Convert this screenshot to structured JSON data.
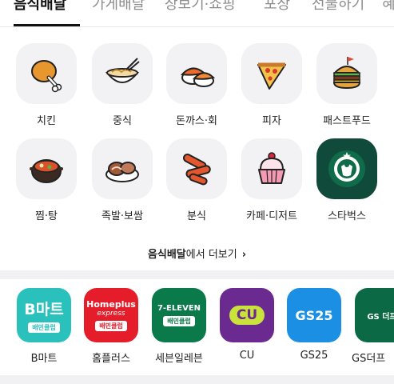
{
  "tabs": {
    "items": [
      {
        "label": "음식배달",
        "active": true
      },
      {
        "label": "가게배달",
        "active": false
      },
      {
        "label": "장보기·쇼핑",
        "active": false
      },
      {
        "label": "포장",
        "active": false
      },
      {
        "label": "선물하기",
        "active": false
      },
      {
        "label": "혜",
        "active": false
      }
    ]
  },
  "categories": [
    {
      "label": "치킨",
      "icon": "fried-chicken-icon"
    },
    {
      "label": "중식",
      "icon": "noodle-bowl-icon"
    },
    {
      "label": "돈까스·회",
      "icon": "sushi-icon"
    },
    {
      "label": "피자",
      "icon": "pizza-icon"
    },
    {
      "label": "패스트푸드",
      "icon": "burger-icon"
    },
    {
      "label": "찜·탕",
      "icon": "stew-pot-icon"
    },
    {
      "label": "족발·보쌈",
      "icon": "pork-hock-icon"
    },
    {
      "label": "분식",
      "icon": "tteokbokki-icon"
    },
    {
      "label": "카페·디저트",
      "icon": "cupcake-icon"
    },
    {
      "label": "스타벅스",
      "icon": "starbucks-logo-icon"
    }
  ],
  "more_link": {
    "bold": "음식배달",
    "rest": "에서 더보기",
    "chevron": "›"
  },
  "marts": [
    {
      "label": "B마트",
      "logo_text": "B마트",
      "badge": "배민클럽",
      "bg": "#2ac1bc"
    },
    {
      "label": "홈플러스",
      "logo_text": "Homeplus",
      "logo_sub": "express",
      "badge": "배민클럽",
      "bg": "#e51d2a"
    },
    {
      "label": "세븐일레븐",
      "logo_text": "7-ELEVEN",
      "badge": "배민클럽",
      "bg": "#0b7a4a"
    },
    {
      "label": "CU",
      "logo_text": "CU",
      "bg": "#6b2a8f"
    },
    {
      "label": "GS25",
      "logo_text": "GS25",
      "bg": "#1a8fe3"
    },
    {
      "label": "GS더프",
      "logo_text": "GS 더프",
      "bg": "#0b6a45"
    }
  ],
  "colors": {
    "accent_mint": "#2ac1bc",
    "starbucks_green": "#0f4a3a"
  }
}
